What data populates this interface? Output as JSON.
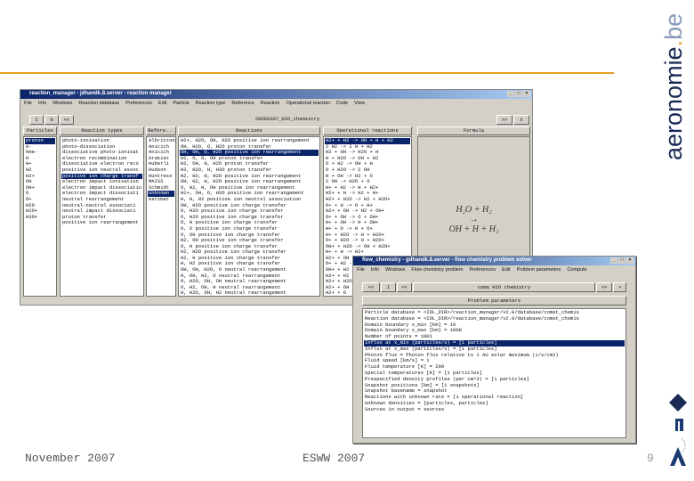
{
  "slide": {
    "footer_left": "November 2007",
    "footer_center": "ESWW 2007",
    "page_number": "9",
    "logo_text": "aeronomie.be",
    "accent_color": "#e3a020"
  },
  "win1": {
    "title": "reaction_manager - jdhandk.8.server - reaction manager",
    "menu": [
      "File",
      "Info",
      "Windows",
      "Reaction database",
      "Preferences",
      "Edit",
      "Particle",
      "Reaction type",
      "Reference",
      "Reaction",
      "Operational reaction",
      "Code",
      "View"
    ],
    "toolbar": {
      "b1": "I",
      "b2": "0",
      "b3": "<<",
      "title": "20060307_H2O_chemistry",
      "b4": ">>",
      "b5": "X"
    },
    "headers": {
      "particles": "Particles",
      "types": "Reaction types",
      "refs": "Refere...",
      "reactions": "Reactions",
      "operational": "Operational reactions",
      "formula": "Formula"
    },
    "particles": [
      "proton",
      "e-",
      "hme-",
      "H",
      "H+",
      "H2",
      "H2+",
      "OH",
      "OH+",
      "O",
      "O+",
      "H2O",
      "H2O+",
      "H3O+"
    ],
    "particles_selected": 0,
    "types": [
      "photo-ionisation",
      "photo-dissociation",
      "dissociative photo-ionisat",
      "electron recombination",
      "dissociative electron reco",
      "positive ion neutral assoc",
      "positive ion charge transf",
      "electron impact ionisation",
      "electron impact dissociatio",
      "electron impact dissociati",
      "neutral rearrangement",
      "neutral-neutral associati",
      "neutral impact dissociati",
      "proton transfer",
      "positive ion rearrangement"
    ],
    "types_selected": 6,
    "refs": [
      "Albritton",
      "Anicich",
      "Anicich",
      "Arakist",
      "Huberli",
      "Hudson",
      "Huntress",
      "MAISS",
      "Schmidt",
      "Unknown",
      "estimat"
    ],
    "refs_selected": 9,
    "reactions": [
      "H2+, H2O, OH, H2O positive ion rearrangement",
      "OH, H2O, O, H2O proton transfer",
      "OH, OH, O, H2O positive ion rearrangement",
      "H2, O, O, OH proton transfer",
      "H2, OH, H, H2O proton transfer",
      "H2, H2O, H, H3O proton transfer",
      "H2, H2, H, H2O positive ion rearrangement",
      "OH, H2, H, H2O positive ion rearrangement",
      "O, H2, H, OH positive ion rearrangement",
      "H2+, OH, O, H2O positive ion rearrangement",
      "H, H, H2 positive ion neutral association",
      "OH, H2O positive ion charge transfer",
      "O, H2O positive ion charge transfer",
      "O, H2O positive ion charge transfer",
      "O, H positive ion charge transfer",
      "O, O positive ion charge transfer",
      "O, OH positive ion charge transfer",
      "H2, OH positive ion charge transfer",
      "O, H positive ion charge transfer",
      "H2, H2O positive ion charge transfer",
      "H2, H positive ion charge transfer",
      "H, H2 positive ion charge transfer",
      "OH, OH, H2O, O neutral rearrangement",
      "H, OH, H2, O neutral rearrangement",
      "O, H2O, OH, OH neutral rearrangement",
      "O, H2, OH, H neutral rearrangement",
      "H, H2O, OH, H2 neutral rearrangement"
    ],
    "reactions_selected": 2,
    "operational": [
      "H2+ + H2 -> OH + H + H2",
      "2 H2 -> 2 H + H2",
      "H2 + OH -> H2O + H",
      "H + H2O -> OH + H2",
      "O + H2 -> OH + H",
      "O + H2O -> 2 OH",
      "H + OH -> H2 + O",
      "2 OH -> H2O + O",
      "H+ + H2 -> H + H2+",
      "H2+ + H -> H2 + H+",
      "H2+ + H2O -> H2 + H2O+",
      "O+ + H -> O + H+",
      "H2+ + OH -> H2 + OH+",
      "O+ + OH -> O + OH+",
      "H+ + OH -> H + OH+",
      "H+ + O -> H + O+",
      "H+ + H2O -> H + H2O+",
      "O+ + H2O -> O + H2O+",
      "OH+ + H2O -> OH + H2O+",
      "H+ + H -> H2+",
      "H2+ + OH -> O + H2O+",
      "O+ + H2 -> H + OH+",
      "OH+ + H2 -> H2O+ + H",
      "H2+ + H2",
      "H2+ + H2O",
      "H2+ + OH",
      "H2+ + O"
    ],
    "operational_selected": 0,
    "formula": {
      "lhs": "H₂O + H₂",
      "arrow": "→",
      "rhs": "OH + H + H₂"
    }
  },
  "win2": {
    "title": "flow_chemistry - gdhandk.8.server - flow chemistry problem solver",
    "menu": [
      "File",
      "Info",
      "Windows",
      "Flow chemistry problem",
      "Preferences",
      "Edit",
      "Problem parameters",
      "Compute"
    ],
    "toolbar": {
      "b1": "<<",
      "b2": "I",
      "b3": "<<",
      "title": "coma H2O chemistry",
      "b4": ">>",
      "b5": ">"
    },
    "params_button": "Problem parameters",
    "lines": [
      "Particle database = <IDL_DIR>/reaction_manager/v2.0/database/comet_chemis",
      "Reaction database = <IDL_DIR>/reaction_manager/v2.0/database/comet_chemis",
      "Domain boundary x_min [km] = 10",
      "Domain boundary x_max [km] = 1000",
      "Number of points = 1001",
      "Influx at x_min (particles/s) = [1 particles]",
      "Influx at x_max (particles/s) = [1 particles]",
      "Photon flux = Photon flux relative to 1 AU solar maximum (1/s/cm2)",
      "Fluid speed [km/s] = 1",
      "Fluid temperature [K] = 200",
      "Special temperatures [K] = [1 particles]",
      "Prespecified density profiles (per cm^3) = [1 particles]",
      "Snapshot positions [km] = [1 snapshots]",
      "Snapshot basename = snapshot",
      "Reactions with unknown rate = [1 operational reaction]",
      "Unknown densities = [particles, particles]",
      "Sources in output = sources"
    ],
    "selected": 5
  }
}
